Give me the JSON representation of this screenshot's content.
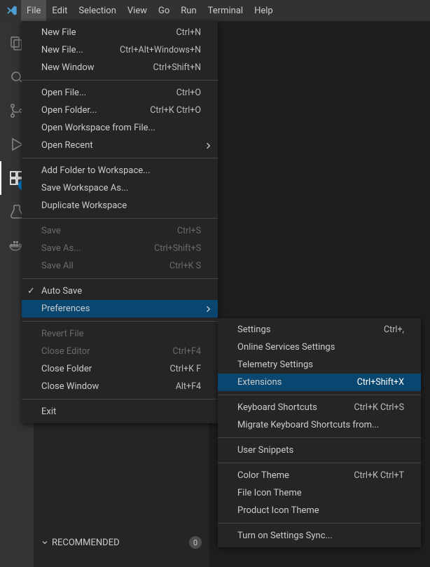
{
  "menubar": {
    "items": [
      "File",
      "Edit",
      "Selection",
      "View",
      "Go",
      "Run",
      "Terminal",
      "Help"
    ],
    "active_index": 0
  },
  "activitybar": {
    "explorer_badge": "",
    "extensions_badge": ""
  },
  "sidebar": {
    "recommended": {
      "label": "RECOMMENDED",
      "count": "0"
    }
  },
  "file_menu": {
    "groups": [
      [
        {
          "label": "New File",
          "shortcut": "Ctrl+N"
        },
        {
          "label": "New File...",
          "shortcut": "Ctrl+Alt+Windows+N"
        },
        {
          "label": "New Window",
          "shortcut": "Ctrl+Shift+N"
        }
      ],
      [
        {
          "label": "Open File...",
          "shortcut": "Ctrl+O"
        },
        {
          "label": "Open Folder...",
          "shortcut": "Ctrl+K Ctrl+O"
        },
        {
          "label": "Open Workspace from File...",
          "shortcut": ""
        },
        {
          "label": "Open Recent",
          "shortcut": "",
          "submenu": true
        }
      ],
      [
        {
          "label": "Add Folder to Workspace...",
          "shortcut": ""
        },
        {
          "label": "Save Workspace As...",
          "shortcut": ""
        },
        {
          "label": "Duplicate Workspace",
          "shortcut": ""
        }
      ],
      [
        {
          "label": "Save",
          "shortcut": "Ctrl+S",
          "disabled": true
        },
        {
          "label": "Save As...",
          "shortcut": "Ctrl+Shift+S",
          "disabled": true
        },
        {
          "label": "Save All",
          "shortcut": "Ctrl+K S",
          "disabled": true
        }
      ],
      [
        {
          "label": "Auto Save",
          "shortcut": "",
          "checked": true
        },
        {
          "label": "Preferences",
          "shortcut": "",
          "submenu": true,
          "highlight": true
        }
      ],
      [
        {
          "label": "Revert File",
          "shortcut": "",
          "disabled": true
        },
        {
          "label": "Close Editor",
          "shortcut": "Ctrl+F4",
          "disabled": true
        },
        {
          "label": "Close Folder",
          "shortcut": "Ctrl+K F"
        },
        {
          "label": "Close Window",
          "shortcut": "Alt+F4"
        }
      ],
      [
        {
          "label": "Exit",
          "shortcut": ""
        }
      ]
    ]
  },
  "preferences_menu": {
    "groups": [
      [
        {
          "label": "Settings",
          "shortcut": "Ctrl+,"
        },
        {
          "label": "Online Services Settings",
          "shortcut": ""
        },
        {
          "label": "Telemetry Settings",
          "shortcut": ""
        },
        {
          "label": "Extensions",
          "shortcut": "Ctrl+Shift+X",
          "highlight": true
        }
      ],
      [
        {
          "label": "Keyboard Shortcuts",
          "shortcut": "Ctrl+K Ctrl+S"
        },
        {
          "label": "Migrate Keyboard Shortcuts from...",
          "shortcut": ""
        }
      ],
      [
        {
          "label": "User Snippets",
          "shortcut": ""
        }
      ],
      [
        {
          "label": "Color Theme",
          "shortcut": "Ctrl+K Ctrl+T"
        },
        {
          "label": "File Icon Theme",
          "shortcut": ""
        },
        {
          "label": "Product Icon Theme",
          "shortcut": ""
        }
      ],
      [
        {
          "label": "Turn on Settings Sync...",
          "shortcut": ""
        }
      ]
    ]
  }
}
